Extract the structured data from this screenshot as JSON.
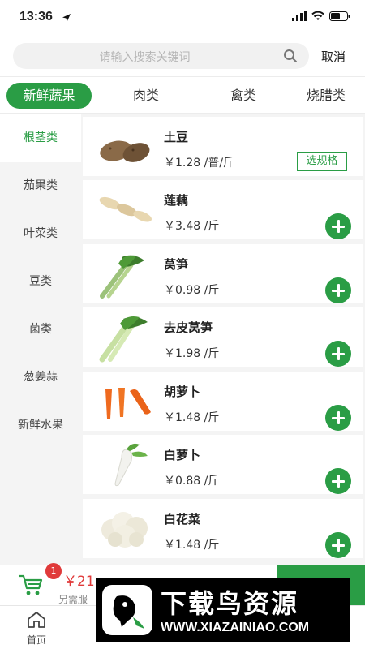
{
  "status_bar": {
    "time": "13:36"
  },
  "search": {
    "placeholder": "请输入搜索关键词",
    "cancel_label": "取消"
  },
  "category_tabs": [
    {
      "label": "新鲜蔬果",
      "active": true
    },
    {
      "label": "肉类",
      "active": false
    },
    {
      "label": "禽类",
      "active": false
    },
    {
      "label": "烧腊类",
      "active": false
    }
  ],
  "sidebar": {
    "items": [
      {
        "label": "根茎类",
        "active": true
      },
      {
        "label": "茄果类",
        "active": false
      },
      {
        "label": "叶菜类",
        "active": false
      },
      {
        "label": "豆类",
        "active": false
      },
      {
        "label": "菌类",
        "active": false
      },
      {
        "label": "葱姜蒜",
        "active": false
      },
      {
        "label": "新鲜水果",
        "active": false
      }
    ]
  },
  "products": [
    {
      "name": "土豆",
      "price": "￥1.28 /普/斤",
      "action": "选规格",
      "icon": "potato"
    },
    {
      "name": "莲藕",
      "price": "￥3.48 /斤",
      "action": "add",
      "icon": "lotus-root"
    },
    {
      "name": "莴笋",
      "price": "￥0.98 /斤",
      "action": "add",
      "icon": "lettuce-stem"
    },
    {
      "name": "去皮莴笋",
      "price": "￥1.98 /斤",
      "action": "add",
      "icon": "peeled-lettuce-stem"
    },
    {
      "name": "胡萝卜",
      "price": "￥1.48 /斤",
      "action": "add",
      "icon": "carrot"
    },
    {
      "name": "白萝卜",
      "price": "￥0.88 /斤",
      "action": "add",
      "icon": "white-radish"
    },
    {
      "name": "白花菜",
      "price": "￥1.48 /斤",
      "action": "add",
      "icon": "cauliflower"
    }
  ],
  "cart": {
    "badge_count": "1",
    "total": "￥21",
    "note": "另需服"
  },
  "bottom_nav": [
    {
      "label": "首页",
      "icon": "home-icon"
    },
    {
      "label": "",
      "icon": "category-icon"
    },
    {
      "label": "",
      "icon": "orders-icon"
    },
    {
      "label": "",
      "icon": "profile-icon"
    }
  ],
  "watermark": {
    "title": "下载鸟资源",
    "url": "WWW.XIAZAINIAO.COM"
  },
  "colors": {
    "accent": "#2a9d45",
    "price_red": "#e03a3a"
  }
}
